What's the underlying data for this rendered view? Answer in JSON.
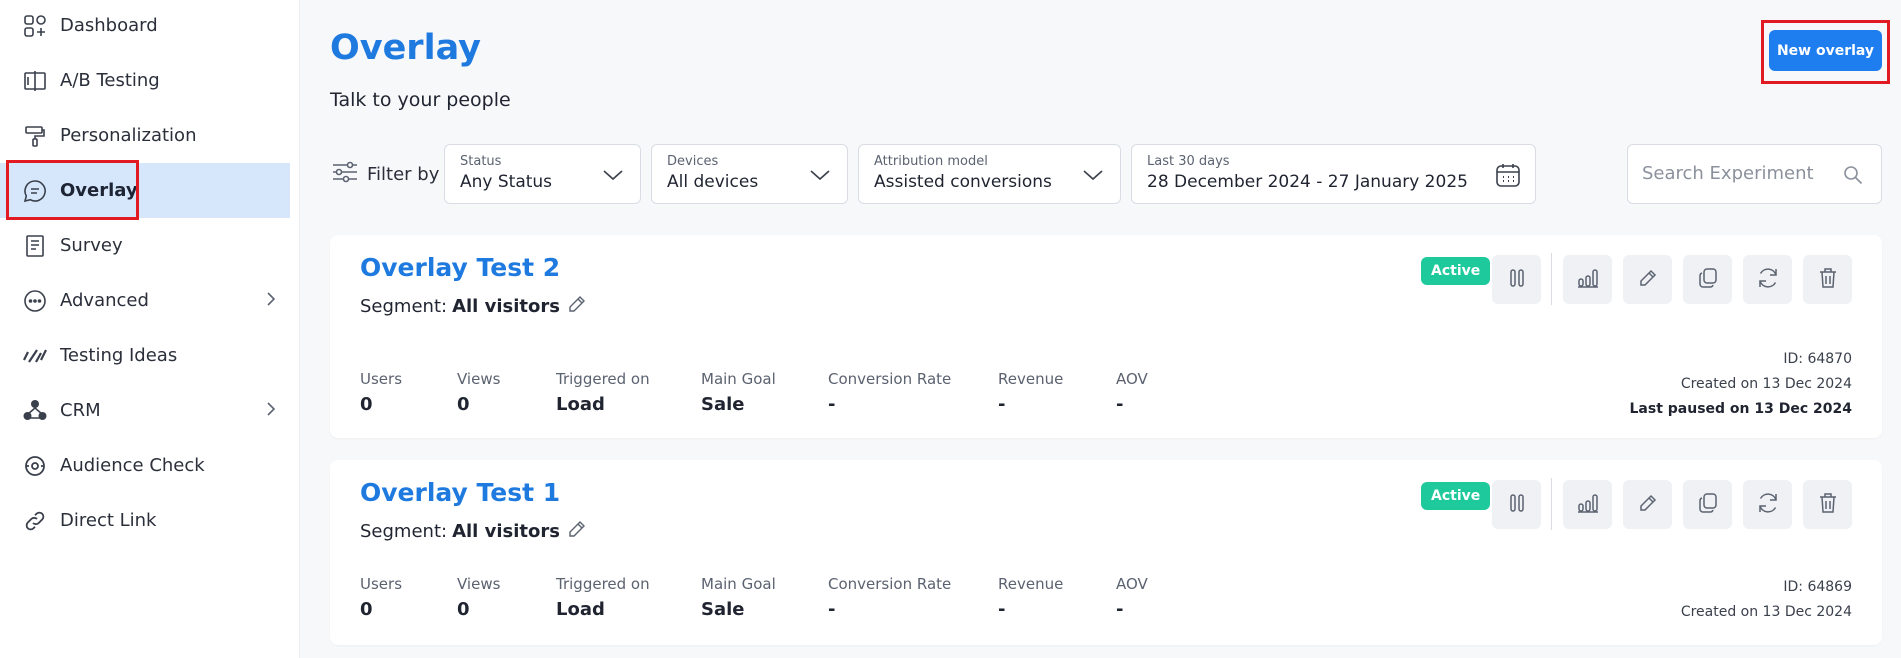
{
  "sidebar": {
    "items": [
      {
        "label": "Dashboard",
        "icon": "dashboard-icon"
      },
      {
        "label": "A/B Testing",
        "icon": "ab-testing-icon"
      },
      {
        "label": "Personalization",
        "icon": "paint-roller-icon"
      },
      {
        "label": "Overlay",
        "icon": "overlay-chat-icon",
        "active": true
      },
      {
        "label": "Survey",
        "icon": "survey-icon"
      },
      {
        "label": "Advanced",
        "icon": "more-dots-icon",
        "has_submenu": true
      },
      {
        "label": "Testing Ideas",
        "icon": "testing-ideas-icon"
      },
      {
        "label": "CRM",
        "icon": "crm-icon",
        "has_submenu": true
      },
      {
        "label": "Audience Check",
        "icon": "audience-check-icon"
      },
      {
        "label": "Direct Link",
        "icon": "link-icon"
      }
    ]
  },
  "header": {
    "title": "Overlay",
    "subtitle": "Talk to your people",
    "new_button": "New overlay"
  },
  "filters": {
    "filter_by_label": "Filter by",
    "status": {
      "label": "Status",
      "value": "Any Status"
    },
    "devices": {
      "label": "Devices",
      "value": "All devices"
    },
    "attribution": {
      "label": "Attribution model",
      "value": "Assisted conversions"
    },
    "date": {
      "label": "Last 30 days",
      "value": "28 December 2024 - 27 January 2025"
    },
    "search_placeholder": "Search Experiment"
  },
  "stat_labels": {
    "users": "Users",
    "views": "Views",
    "triggered": "Triggered on",
    "goal": "Main Goal",
    "conversion": "Conversion Rate",
    "revenue": "Revenue",
    "aov": "AOV"
  },
  "segment_label": "Segment:",
  "experiments": [
    {
      "title": "Overlay Test 2",
      "segment": "All visitors",
      "status": "Active",
      "users": "0",
      "views": "0",
      "triggered": "Load",
      "goal": "Sale",
      "conversion": "-",
      "revenue": "-",
      "aov": "-",
      "id": "ID: 64870",
      "created": "Created on 13 Dec 2024",
      "last_paused": "Last paused on 13 Dec 2024"
    },
    {
      "title": "Overlay Test 1",
      "segment": "All visitors",
      "status": "Active",
      "users": "0",
      "views": "0",
      "triggered": "Load",
      "goal": "Sale",
      "conversion": "-",
      "revenue": "-",
      "aov": "-",
      "id": "ID: 64869",
      "created": "Created on 13 Dec 2024"
    }
  ],
  "colors": {
    "accent": "#1f7ae0",
    "button": "#1e7ef0",
    "active_badge": "#1ec99b",
    "active_nav_bg": "#d6e7fb",
    "highlight_box": "#e21b23"
  }
}
